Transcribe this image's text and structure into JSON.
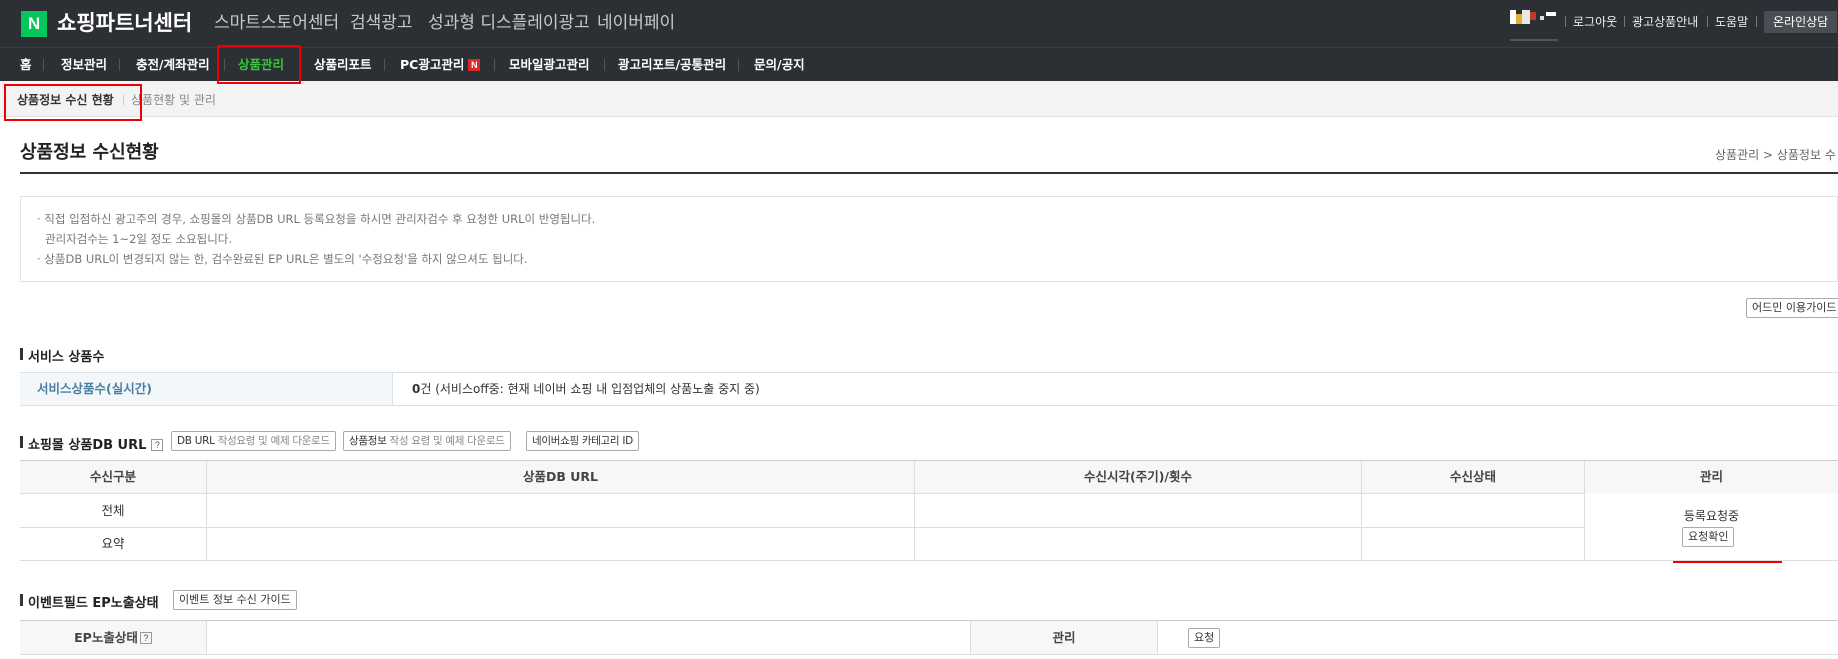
{
  "header": {
    "logo_letter": "N",
    "logo_text": "쇼핑파트너센터",
    "services": [
      "스마트스토어센터",
      "검색광고",
      "성과형 디스플레이광고",
      "네이버페이"
    ],
    "util_links": [
      "로그아웃",
      "광고상품안내",
      "도움말"
    ],
    "online_button": "온라인상담"
  },
  "gnb": {
    "items": [
      "홈",
      "정보관리",
      "충전/계좌관리",
      "상품관리",
      "상품리포트",
      "PC광고관리",
      "모바일광고관리",
      "광고리포트/공통관리",
      "문의/공지"
    ],
    "new_badge": "N",
    "active_color": "#35c93b"
  },
  "subnav": {
    "current": "상품정보 수신 현황",
    "other": "상품현황 및 관리"
  },
  "page": {
    "title": "상품정보 수신현황",
    "breadcrumb": "상품관리 > 상품정보 수"
  },
  "notice": {
    "line1": "· 직접 입점하신 광고주의 경우, 쇼핑몰의 상품DB URL 등록요청을 하시면 관리자검수 후 요청한 URL이 반영됩니다.",
    "line2": "관리자검수는 1~2일 정도 소요됩니다.",
    "line3": "· 상품DB URL이 변경되지 않는 한, 검수완료된 EP URL은 별도의 '수정요청'을 하지 않으셔도 됩니다."
  },
  "admin_guide_button": "어드민 이용가이드",
  "service_count": {
    "section_title": "서비스 상품수",
    "label": "서비스상품수(실시간)",
    "value_bold": "0",
    "value_text": "건 (서비스off중: 현재 네이버 쇼핑 내 입점업체의 상품노출 중지 중)"
  },
  "db_url": {
    "section_title": "쇼핑몰 상품DB URL",
    "help": "?",
    "buttons": [
      {
        "strong": "DB URL",
        "light": " 작성요령 및 예제 다운로드"
      },
      {
        "strong": "상품정보",
        "light": " 작성 요령 및 예제 다운로드"
      },
      {
        "strong": "네이버쇼핑 카테고리 ID",
        "light": ""
      }
    ],
    "columns": [
      "수신구분",
      "상품DB URL",
      "수신시각(주기)/횟수",
      "수신상태",
      "관리"
    ],
    "rows": [
      "전체",
      "요약"
    ],
    "manage_status": "등록요청중",
    "manage_button": "요청확인"
  },
  "event": {
    "section_title": "이벤트필드 EP노출상태",
    "guide_button": "이벤트 정보 수신 가이드",
    "ep_label": "EP노출상태",
    "help": "?",
    "manage_label": "관리",
    "request_button": "요청"
  }
}
